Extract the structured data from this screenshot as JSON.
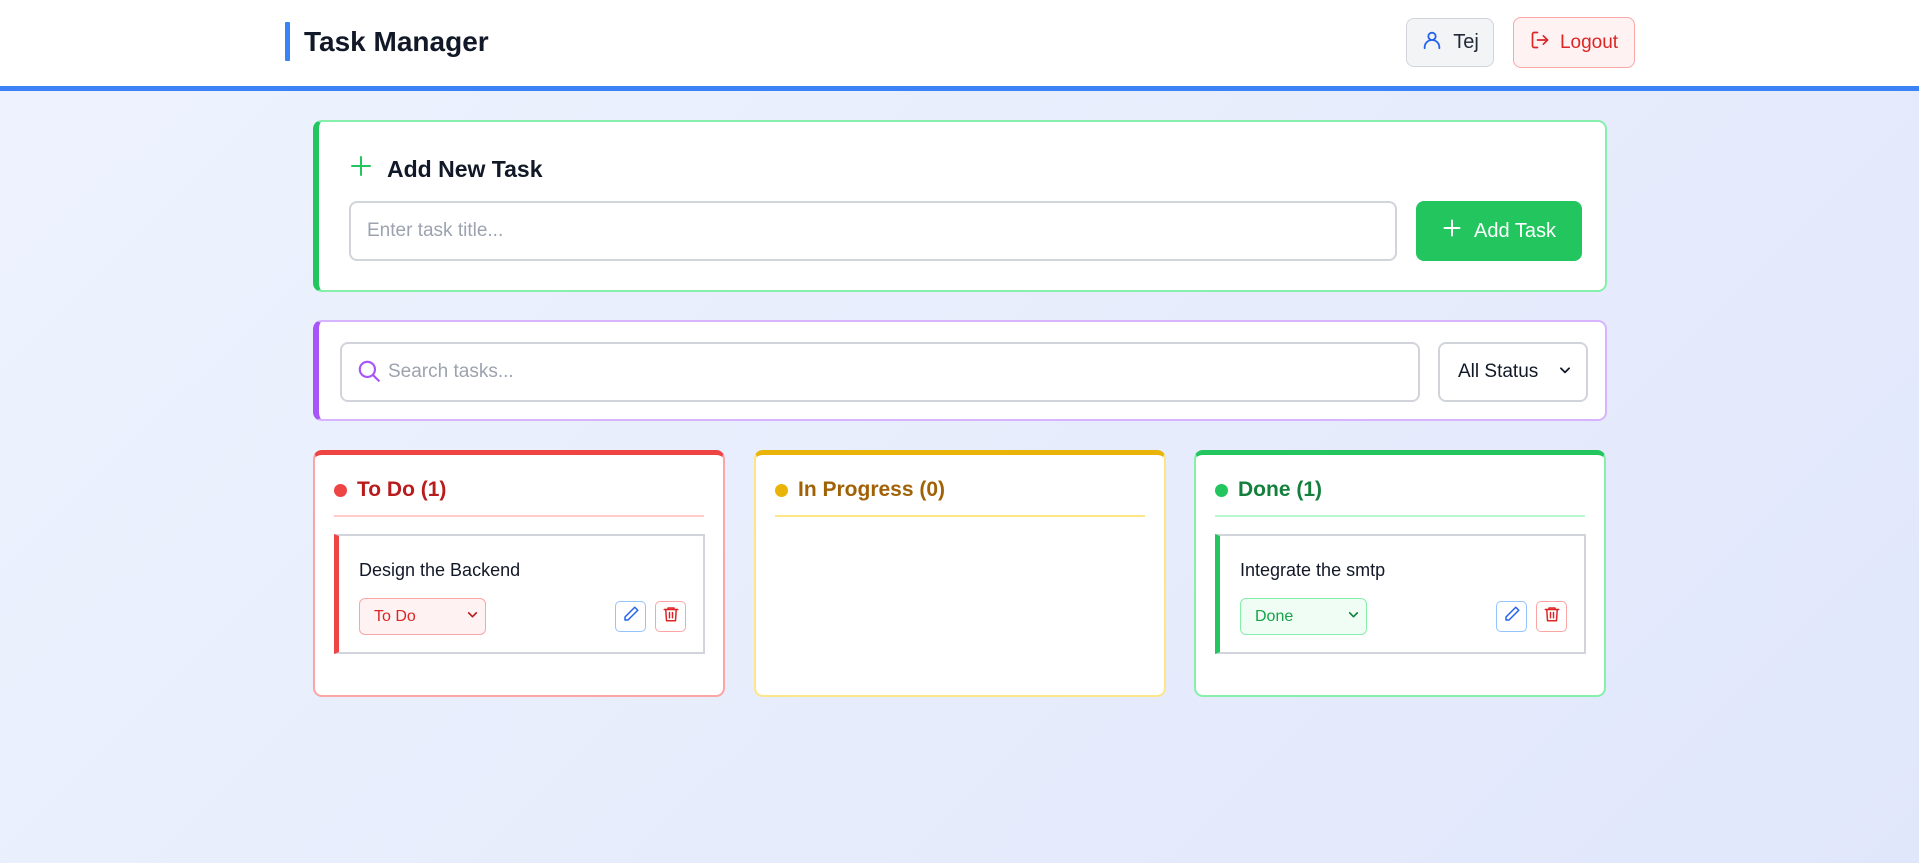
{
  "header": {
    "title": "Task Manager",
    "user_name": "Tej",
    "logout_label": "Logout"
  },
  "add_task": {
    "heading": "Add New Task",
    "input_placeholder": "Enter task title...",
    "input_value": "",
    "button_label": "Add Task"
  },
  "filters": {
    "search_placeholder": "Search tasks...",
    "search_value": "",
    "status_selected": "All Status"
  },
  "columns": [
    {
      "title": "To Do (1)",
      "accent": "#ef4444",
      "tasks": [
        {
          "title": "Design the Backend",
          "status": "To Do"
        }
      ]
    },
    {
      "title": "In Progress (0)",
      "accent": "#eab308",
      "tasks": []
    },
    {
      "title": "Done (1)",
      "accent": "#22c55e",
      "tasks": [
        {
          "title": "Integrate the smtp",
          "status": "Done"
        }
      ]
    }
  ],
  "icons": [
    "user-icon",
    "logout-icon",
    "plus-icon",
    "search-icon",
    "chevron-down-icon",
    "pencil-icon",
    "trash-icon"
  ],
  "colors": {
    "primary": "#3b82f6",
    "success": "#22c55e",
    "danger": "#ef4444",
    "warning": "#eab308",
    "purple": "#a855f7"
  }
}
